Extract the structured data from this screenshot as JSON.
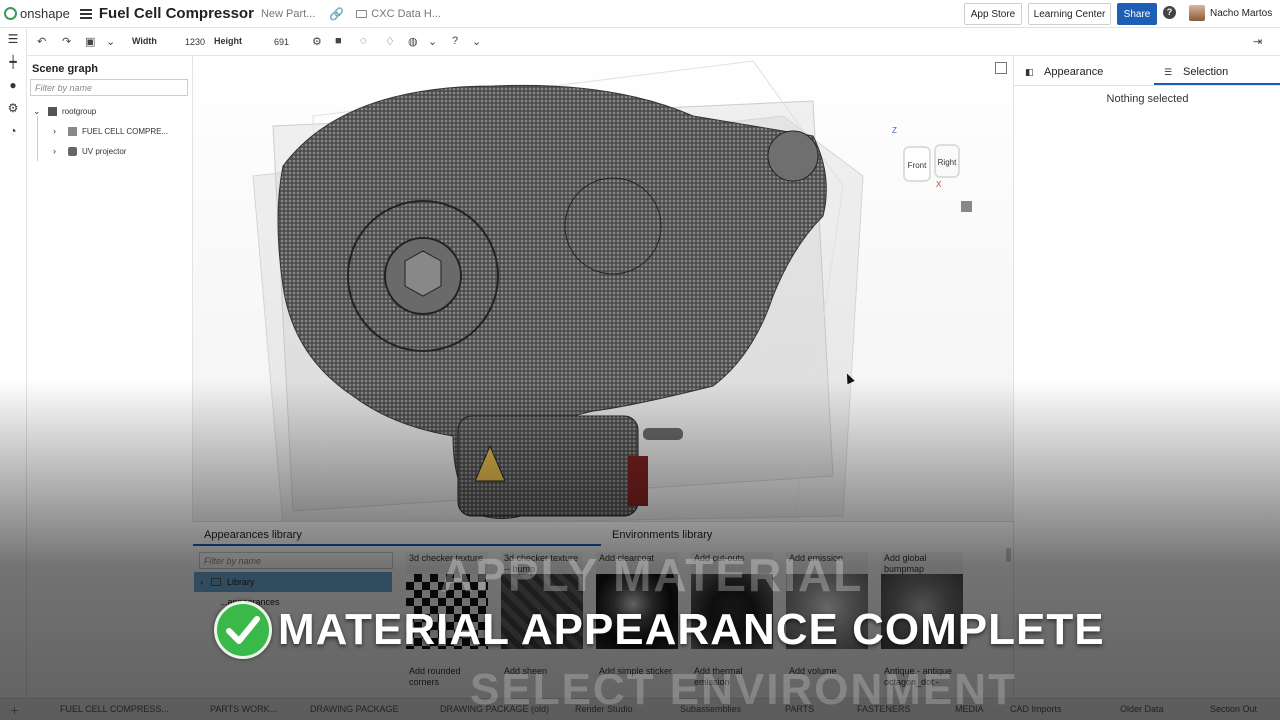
{
  "header": {
    "logo_text": "onshape",
    "doc_title": "Fuel Cell Compressor",
    "doc_subtitle": "New Part...",
    "folder_label": "CXC Data H...",
    "app_store": "App Store",
    "learning_center": "Learning Center",
    "share": "Share",
    "help": "?",
    "user_name": "Nacho Martos"
  },
  "toolbar": {
    "width_label": "Width",
    "width_value": "1230",
    "height_label": "Height",
    "height_value": "691"
  },
  "scene_graph": {
    "title": "Scene graph",
    "filter_placeholder": "Filter by name",
    "root": "rootgroup",
    "children": [
      "FUEL CELL COMPRE...",
      "UV projector"
    ]
  },
  "viewcube": {
    "front": "Front",
    "right": "Right",
    "axis_x": "X",
    "axis_z": "Z"
  },
  "right_panel": {
    "tab_appearance": "Appearance",
    "tab_selection": "Selection",
    "empty_message": "Nothing selected"
  },
  "libraries": {
    "tab_appearances": "Appearances library",
    "tab_environments": "Environments library",
    "filter_placeholder": "Filter by name",
    "tree": [
      "Library",
      "...appearances"
    ],
    "tiles_top": [
      "3d checker texture",
      "3d checker texture -- bump",
      "Add clearcoat",
      "Add cut-outs",
      "Add emission",
      "Add global bumpmap"
    ],
    "tiles_bottom": [
      "Add rounded corners",
      "Add sheen",
      "Add simple sticker",
      "Add thermal emission",
      "Add volume",
      "Antique - antique octagon_dot -"
    ]
  },
  "bottom_tabs": [
    "FUEL CELL COMPRESS...",
    "PARTS WORK...",
    "DRAWING PACKAGE",
    "DRAWING PACKAGE (old)",
    "Render Studio",
    "Subassemblies",
    "PARTS",
    "FASTENERS",
    "MEDIA",
    "CAD Imports",
    "Older Data",
    "Section Out"
  ],
  "overlay": {
    "banner": "MATERIAL APPEARANCE COMPLETE",
    "ghost_top": "APPLY MATERIAL",
    "ghost_bottom": "SELECT ENVIRONMENT"
  },
  "colors": {
    "accent": "#1d5fb5",
    "check_green": "#3bb84a",
    "onshape_green": "#3a9b57"
  }
}
